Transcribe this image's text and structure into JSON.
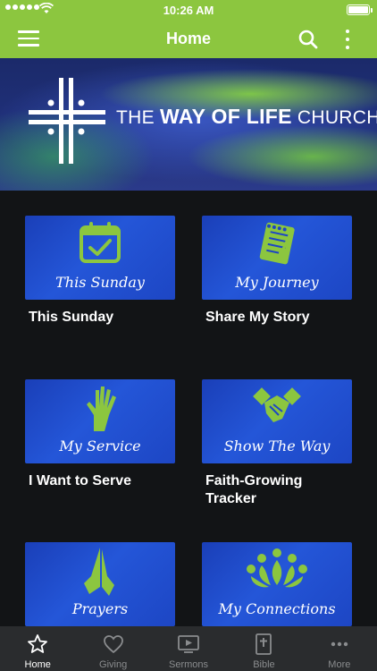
{
  "status": {
    "time": "10:26 AM"
  },
  "header": {
    "title": "Home"
  },
  "banner": {
    "name_prefix": "THE ",
    "name_bold": "WAY OF LIFE",
    "name_suffix": " CHURCH"
  },
  "tiles": [
    {
      "script": "This Sunday",
      "label": "This Sunday",
      "icon": "calendar-check-icon"
    },
    {
      "script": "My Journey",
      "label": "Share My Story",
      "icon": "notebook-icon"
    },
    {
      "script": "My Service",
      "label": "I Want to Serve",
      "icon": "raised-hand-icon"
    },
    {
      "script": "Show The Way",
      "label": "Faith-Growing Tracker",
      "icon": "handshake-icon"
    },
    {
      "script": "Prayers",
      "label": "",
      "icon": "praying-hands-icon"
    },
    {
      "script": "My Connections",
      "label": "",
      "icon": "people-circle-icon"
    }
  ],
  "tabs": [
    {
      "label": "Home",
      "icon": "star-icon",
      "active": true
    },
    {
      "label": "Giving",
      "icon": "heart-icon"
    },
    {
      "label": "Sermons",
      "icon": "video-play-icon"
    },
    {
      "label": "Bible",
      "icon": "bible-icon"
    },
    {
      "label": "More",
      "icon": "more-dots-icon"
    }
  ],
  "colors": {
    "accent": "#8cc63f",
    "tile_blue": "#2456d8",
    "background": "#121416",
    "tabbar": "#2a2c2e"
  }
}
